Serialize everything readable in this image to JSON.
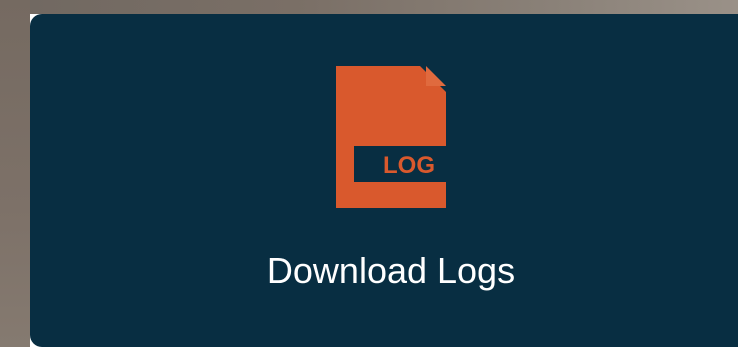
{
  "tile": {
    "label": "Download Logs",
    "icon": "log-file-icon",
    "icon_text": "LOG"
  },
  "colors": {
    "tile_background": "#082e42",
    "icon_accent": "#d9592d",
    "label_text": "#ffffff"
  }
}
